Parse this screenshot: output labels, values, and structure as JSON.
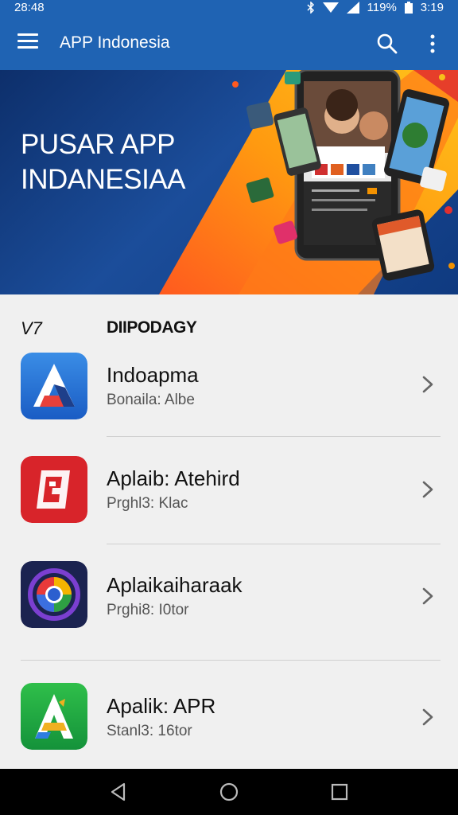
{
  "status": {
    "time": "28:48",
    "battery": "119%",
    "clock": "3:19"
  },
  "toolbar": {
    "title": "APP Indonesia"
  },
  "banner": {
    "line1": "PUSAR APP",
    "line2": "INDANESIAA"
  },
  "section": {
    "left": "V7",
    "right": "DIIPODAGY"
  },
  "apps": [
    {
      "name": "Indoapma",
      "sub": "Bonaila: Albe",
      "icon": "a-logo-icon"
    },
    {
      "name": "Aplaib: Atehird",
      "sub": "Prghl3: Klac",
      "icon": "red-e-logo-icon"
    },
    {
      "name": "Aplaikaiharaak",
      "sub": "Prghi8: I0tor",
      "icon": "color-ring-logo-icon"
    },
    {
      "name": "Apalik: APR",
      "sub": "Stanl3: 16tor",
      "icon": "green-a-logo-icon"
    }
  ],
  "colors": {
    "toolbar": "#1f63b3",
    "banner_blue": "#0d2f6b",
    "accent_orange": "#f39200"
  }
}
